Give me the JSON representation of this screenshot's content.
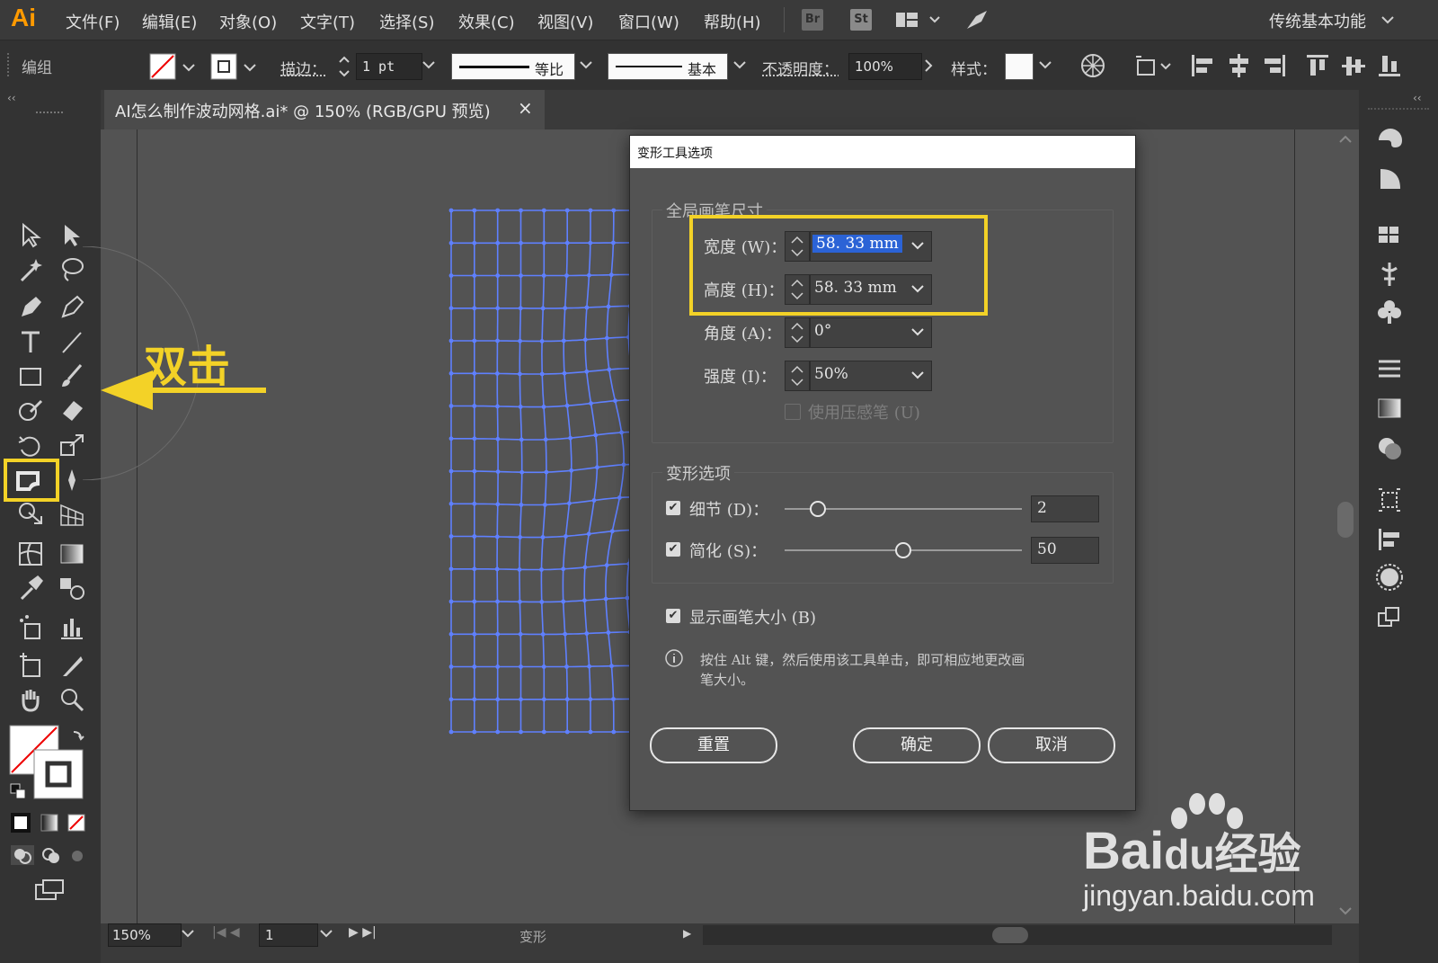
{
  "app": {
    "logo": "Ai",
    "workspace": "传统基本功能"
  },
  "menu": [
    "文件(F)",
    "编辑(E)",
    "对象(O)",
    "文字(T)",
    "选择(S)",
    "效果(C)",
    "视图(V)",
    "窗口(W)",
    "帮助(H)"
  ],
  "badges": {
    "br": "Br",
    "st": "St"
  },
  "control_bar": {
    "group_label": "编组",
    "stroke_label": "描边：",
    "stroke_value": "1 pt",
    "profile_label": "等比",
    "brush_label": "基本",
    "opacity_label": "不透明度：",
    "opacity_value": "100%",
    "style_label": "样式："
  },
  "document_tab": {
    "title": "AI怎么制作波动网格.ai* @ 150% (RGB/GPU 预览)",
    "close": "×"
  },
  "annotation": {
    "text": "双击",
    "color": "#f3d227"
  },
  "status_bar": {
    "zoom": "150%",
    "artboard": "1",
    "tool_name": "变形"
  },
  "dialog": {
    "title": "变形工具选项",
    "global_brush_group": "全局画笔尺寸",
    "width_label": "宽度 (W)：",
    "width_value": "58. 33  mm",
    "height_label": "高度 (H)：",
    "height_value": "58. 33  mm",
    "angle_label": "角度 (A)：",
    "angle_value": "0°",
    "intensity_label": "强度 (I)：",
    "intensity_value": "50%",
    "pressure_label": "使用压感笔 (U)",
    "warp_group": "变形选项",
    "detail_label": "细节 (D)：",
    "detail_value": "2",
    "detail_level": 0.14,
    "simplify_label": "简化 (S)：",
    "simplify_value": "50",
    "simplify_level": 0.5,
    "show_brush_label": "显示画笔大小 (B)",
    "info_text_line1": "按住 Alt 键，然后使用该工具单击，即可相应地更改画",
    "info_text_line2": "笔大小。",
    "reset_button": "重置",
    "ok_button": "确定",
    "cancel_button": "取消"
  },
  "watermark": {
    "brand": "Bai",
    "brand_du": "du",
    "brand_cn": "经验",
    "url": "jingyan.baidu.com"
  }
}
